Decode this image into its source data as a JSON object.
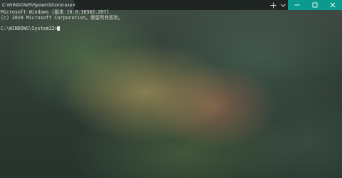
{
  "tab": {
    "title": "C:\\WINDOWS\\System32\\cmd.exe",
    "close_icon": "close-icon"
  },
  "toolbar": {
    "new_tab_icon": "plus-icon",
    "dropdown_icon": "chevron-down-icon"
  },
  "window_controls": {
    "minimize_icon": "minimize-icon",
    "maximize_icon": "maximize-icon",
    "close_icon": "close-icon",
    "accent_color": "#0a9b8e"
  },
  "terminal": {
    "lines": [
      "Microsoft Windows [版本 10.0.18362.207]",
      "(c) 2019 Microsoft Corporation。保留所有权利。",
      "",
      "C:\\WINDOWS\\System32>"
    ]
  }
}
